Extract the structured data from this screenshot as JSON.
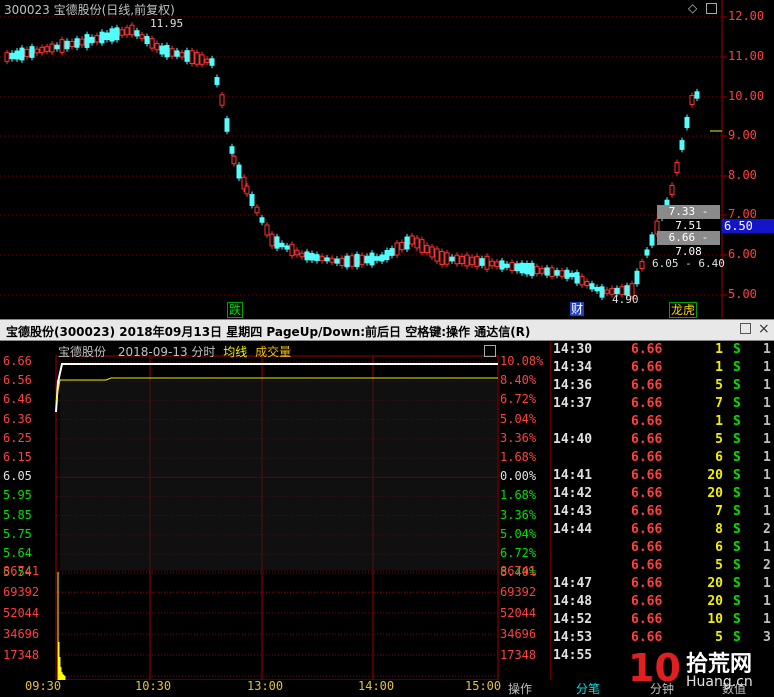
{
  "kline": {
    "title": "300023 宝德股份(日线,前复权)",
    "corner_icon": "◇",
    "right_ticks": [
      "12.00",
      "11.00",
      "10.00",
      "9.00",
      "8.00",
      "7.00",
      "6.00",
      "5.00"
    ],
    "current_price": "6.50",
    "zones": [
      "7.33 - 7.51",
      "6.66 - 7.08",
      "6.05 - 6.40"
    ],
    "high_label": "11.95",
    "low_label": "4.90",
    "tags": {
      "die": "跌",
      "cai": "财",
      "longhu": "龙虎"
    },
    "colors": {
      "up": "#ff3232",
      "down": "#54fcfc",
      "grid": "#800000"
    }
  },
  "infobar": {
    "text": "宝德股份(300023)  2018年09月13日 星期四  PageUp/Down:前后日  空格键:操作  通达信(R)"
  },
  "intraday": {
    "name": "宝德股份",
    "date": "2018-09-13 分时",
    "avg_label": "均线",
    "vol_label": "成交量",
    "price_ticks": [
      "6.66",
      "6.56",
      "6.46",
      "6.36",
      "6.25",
      "6.15",
      "6.05",
      "5.95",
      "5.85",
      "5.75",
      "5.64",
      "5.54"
    ],
    "pct_ticks": [
      "10.08%",
      "8.40%",
      "6.72%",
      "5.04%",
      "3.36%",
      "1.68%",
      "0.00%",
      "1.68%",
      "3.36%",
      "5.04%",
      "6.72%",
      "8.40%"
    ],
    "vol_ticks": [
      "86741",
      "69392",
      "52044",
      "34696",
      "17348"
    ],
    "time_ticks": [
      "09:30",
      "10:30",
      "13:00",
      "14:00",
      "15:00"
    ]
  },
  "ticks": [
    {
      "time": "14:30",
      "price": "6.66",
      "vol": "1",
      "bs": "S",
      "n": "1"
    },
    {
      "time": "14:34",
      "price": "6.66",
      "vol": "1",
      "bs": "S",
      "n": "1"
    },
    {
      "time": "14:36",
      "price": "6.66",
      "vol": "5",
      "bs": "S",
      "n": "1"
    },
    {
      "time": "14:37",
      "price": "6.66",
      "vol": "7",
      "bs": "S",
      "n": "1"
    },
    {
      "time": "",
      "price": "6.66",
      "vol": "1",
      "bs": "S",
      "n": "1"
    },
    {
      "time": "14:40",
      "price": "6.66",
      "vol": "5",
      "bs": "S",
      "n": "1"
    },
    {
      "time": "",
      "price": "6.66",
      "vol": "6",
      "bs": "S",
      "n": "1"
    },
    {
      "time": "14:41",
      "price": "6.66",
      "vol": "20",
      "bs": "S",
      "n": "1"
    },
    {
      "time": "14:42",
      "price": "6.66",
      "vol": "20",
      "bs": "S",
      "n": "1"
    },
    {
      "time": "14:43",
      "price": "6.66",
      "vol": "7",
      "bs": "S",
      "n": "1"
    },
    {
      "time": "14:44",
      "price": "6.66",
      "vol": "8",
      "bs": "S",
      "n": "2"
    },
    {
      "time": "",
      "price": "6.66",
      "vol": "6",
      "bs": "S",
      "n": "1"
    },
    {
      "time": "",
      "price": "6.66",
      "vol": "5",
      "bs": "S",
      "n": "2"
    },
    {
      "time": "14:47",
      "price": "6.66",
      "vol": "20",
      "bs": "S",
      "n": "1"
    },
    {
      "time": "14:48",
      "price": "6.66",
      "vol": "20",
      "bs": "S",
      "n": "1"
    },
    {
      "time": "14:52",
      "price": "6.66",
      "vol": "10",
      "bs": "S",
      "n": "1"
    },
    {
      "time": "14:53",
      "price": "6.66",
      "vol": "5",
      "bs": "S",
      "n": "3"
    },
    {
      "time": "14:55",
      "price": "",
      "vol": "",
      "bs": "",
      "n": ""
    }
  ],
  "bottom_tabs": {
    "op": "操作",
    "fenbi": "分笔",
    "fenzhong": "分钟",
    "value": "数值"
  },
  "watermark": {
    "big": "10",
    "cn": "拾荒网",
    "en": "Huang.cn"
  }
}
